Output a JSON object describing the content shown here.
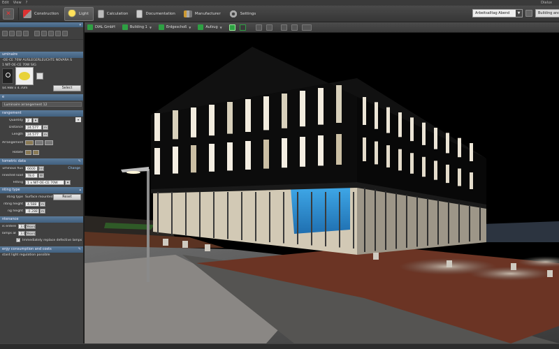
{
  "menubar": {
    "items": [
      "Edit",
      "View",
      "?"
    ],
    "right": "Dialux"
  },
  "ribbon": {
    "tabs": [
      {
        "label": "Construction",
        "icon": "construction-icon",
        "active": false
      },
      {
        "label": "Light",
        "icon": "light-icon",
        "active": true
      },
      {
        "label": "Calculation",
        "icon": "calculation-icon",
        "active": false
      },
      {
        "label": "Documentation",
        "icon": "documentation-icon",
        "active": false
      },
      {
        "label": "Manufacturer",
        "icon": "manufacturer-icon",
        "active": false
      },
      {
        "label": "Settings",
        "icon": "settings-icon",
        "active": false
      }
    ],
    "scene_select": "Arbeitsalltag Abend",
    "right_button": "Building and"
  },
  "left_panel": {
    "luminaire_header": "uminaire",
    "luminaire_name_1": "-OE-CE 70W AUSLEGERLEUCHTE NOVARA S",
    "luminaire_name_2": "1 NIT-OE-CE 70W SIG",
    "luminaire_dims": "$4.988 x 4.70m",
    "select_button": "Select",
    "name_header": "e",
    "name_value": "Luminaire arrangement 12",
    "arrangement_header": "rangement",
    "quantity_label": "Quantity",
    "quantity_value": "2",
    "distance_label": "Distance",
    "distance_value": "24.577",
    "distance_unit": "m",
    "length_label": "Length",
    "length_value": "24.577",
    "length_unit": "m",
    "arrangement_label": "Arrangement",
    "rotate_label": "Rotate",
    "photometric_header": "tometric data",
    "flux_label": "uminous flux",
    "flux_value": "6600",
    "flux_unit": "lm",
    "change_link": "Change",
    "load_label": "nnected load",
    "load_value": "78.0",
    "load_unit": "W",
    "fitting_label": "Fitting",
    "fitting_value": "1 x NIT-OE-CE 70W",
    "mounting_header": "nting type",
    "mounting_type_label": "nting type",
    "mounting_type_value": "Surface mounted",
    "reset_button": "Reset",
    "mount_height_label": "nting height",
    "mount_height_value": "4.588",
    "mount_height_unit": "m",
    "ceiling_height_label": "ng height",
    "ceiling_height_value": "-0.288",
    "ceiling_height_unit": "m",
    "maintenance_header": "ntenance",
    "interval_label": "is entered",
    "interval_value": "3.0",
    "interval_unit": "Years",
    "lamps_label": "lamps all",
    "lamps_value": "3.0",
    "lamps_unit": "Years",
    "replace_label": "Immediately replace defective lamps",
    "energy_header": "ergy consumption and costs",
    "regulation_text": "stant light regulation possible"
  },
  "viewport_toolbar": {
    "items": [
      {
        "label": "DIAL GmbH",
        "icon": "project-icon"
      },
      {
        "label": "Building 1",
        "icon": "building-icon"
      },
      {
        "label": "Erdgeschoß",
        "icon": "floor-icon"
      },
      {
        "label": "Aufzug",
        "icon": "room-icon"
      }
    ]
  },
  "colors": {
    "accent_blue": "#41607e",
    "active_tab": "#656565",
    "glass_blue": "#3fa8e8",
    "green_tool": "#2ea043"
  }
}
